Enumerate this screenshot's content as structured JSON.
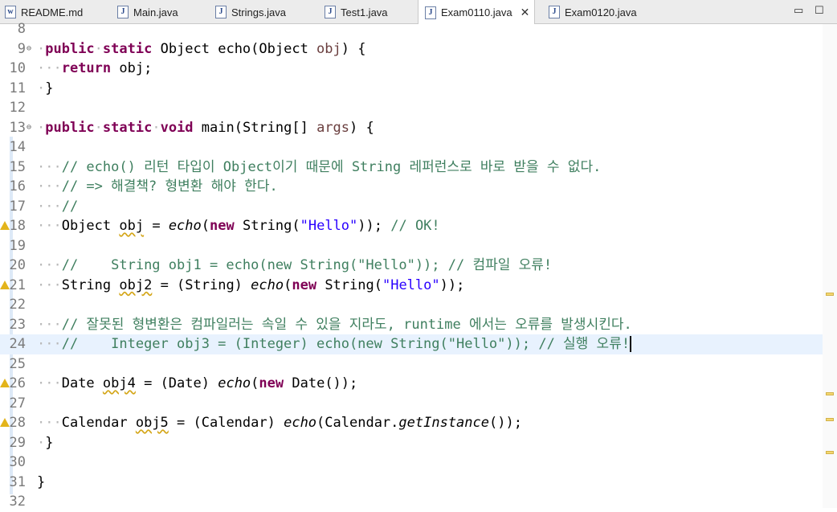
{
  "tabs": [
    {
      "label": "README.md",
      "icon": "markdown-file-icon",
      "active": false
    },
    {
      "label": "Main.java",
      "icon": "java-file-icon",
      "active": false
    },
    {
      "label": "Strings.java",
      "icon": "java-file-icon",
      "active": false
    },
    {
      "label": "Test1.java",
      "icon": "java-file-icon",
      "active": false
    },
    {
      "label": "Exam0110.java",
      "icon": "java-file-icon",
      "active": true
    },
    {
      "label": "Exam0120.java",
      "icon": "java-file-icon",
      "active": false
    }
  ],
  "tab_close_glyph": "✕",
  "window_controls": {
    "minimize": "▭",
    "maximize": "☐"
  },
  "line_numbers": [
    "8",
    "9",
    "10",
    "11",
    "12",
    "13",
    "14",
    "15",
    "16",
    "17",
    "18",
    "19",
    "20",
    "21",
    "22",
    "23",
    "24",
    "25",
    "26",
    "27",
    "28",
    "29",
    "30",
    "31",
    "32"
  ],
  "code": {
    "l9": {
      "mod": "public",
      "stat": "static",
      "rest": " Object echo(Object ",
      "p": "obj",
      "end": ") {"
    },
    "l10": {
      "kw": "return",
      "rest": " obj;"
    },
    "l11": "}",
    "l13": {
      "mod": "public",
      "stat": "static",
      "void": "void",
      "rest": " main(String[] ",
      "p": "args",
      "end": ") {"
    },
    "l15": "// echo() 리턴 타입이 Object이기 때문에 String 레퍼런스로 바로 받을 수 없다.",
    "l16": "// => 해결책? 형변환 해야 한다.",
    "l17": "//",
    "l18": {
      "a": "Object ",
      "v": "obj",
      "b": " = ",
      "f": "echo",
      "c": "(",
      "n": "new",
      "d": " String(",
      "s": "\"Hello\"",
      "e": ")); ",
      "cm": "// OK!"
    },
    "l20": "//    String obj1 = echo(new String(\"Hello\")); // 컴파일 오류!",
    "l21": {
      "a": "String ",
      "v": "obj2",
      "b": " = (String) ",
      "f": "echo",
      "c": "(",
      "n": "new",
      "d": " String(",
      "s": "\"Hello\"",
      "e": "));"
    },
    "l23": "// 잘못된 형변환은 컴파일러는 속일 수 있을 지라도, runtime 에서는 오류를 발생시킨다.",
    "l24": "//    Integer obj3 = (Integer) echo(new String(\"Hello\")); // 실행 오류!",
    "l26": {
      "a": "Date ",
      "v": "obj4",
      "b": " = (Date) ",
      "f": "echo",
      "c": "(",
      "n": "new",
      "d": " Date());"
    },
    "l28": {
      "a": "Calendar ",
      "v": "obj5",
      "b": " = (Calendar) ",
      "f": "echo",
      "c": "(Calendar.",
      "g": "getInstance",
      "e": "());"
    },
    "l29": "}",
    "l31": "}"
  }
}
